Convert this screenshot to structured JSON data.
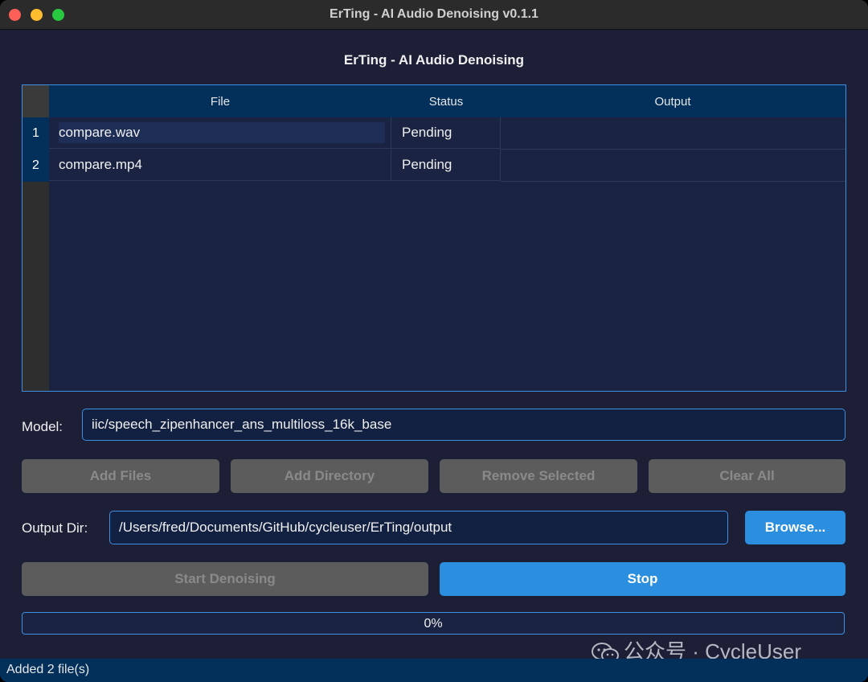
{
  "window": {
    "title": "ErTing - AI Audio Denoising v0.1.1"
  },
  "app": {
    "heading": "ErTing - AI Audio Denoising"
  },
  "table": {
    "columns": [
      "File",
      "Status",
      "Output"
    ],
    "rows": [
      {
        "num": "1",
        "file": "compare.wav",
        "status": "Pending",
        "output": ""
      },
      {
        "num": "2",
        "file": "compare.mp4",
        "status": "Pending",
        "output": ""
      }
    ]
  },
  "model": {
    "label": "Model:",
    "value": "iic/speech_zipenhancer_ans_multiloss_16k_base"
  },
  "buttons": {
    "add_files": "Add Files",
    "add_directory": "Add Directory",
    "remove_selected": "Remove Selected",
    "clear_all": "Clear All",
    "browse": "Browse...",
    "start": "Start Denoising",
    "stop": "Stop"
  },
  "output_dir": {
    "label": "Output Dir:",
    "value": "/Users/fred/Documents/GitHub/cycleuser/ErTing/output"
  },
  "progress": {
    "value_percent": 0,
    "text": "0%"
  },
  "watermark": {
    "text": "公众号 · CycleUser",
    "icon": "wechat-icon"
  },
  "statusbar": {
    "text": "Added 2 file(s)"
  },
  "colors": {
    "accent": "#2b8ede",
    "background": "#1c1f36",
    "header": "#02305a",
    "border": "#3f8fe0",
    "disabled": "#5c5c5c"
  }
}
